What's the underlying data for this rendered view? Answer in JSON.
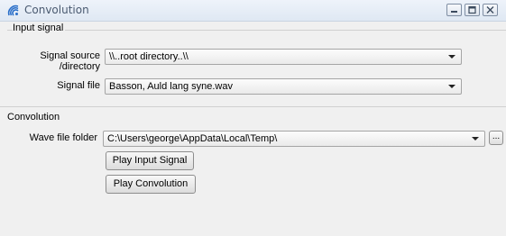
{
  "window": {
    "title": "Convolution",
    "icon": "convolution-wave-icon",
    "controls": [
      "minimize-icon",
      "maximize-icon",
      "close-icon"
    ]
  },
  "input_signal": {
    "group_label": "Input signal",
    "signal_source_label": "Signal source /directory",
    "signal_source_value": "\\\\..root directory..\\\\",
    "signal_file_label": "Signal file",
    "signal_file_value": "Basson, Auld lang syne.wav"
  },
  "convolution": {
    "group_label": "Convolution",
    "wave_folder_label": "Wave file folder",
    "wave_folder_value": "C:\\Users\\george\\AppData\\Local\\Temp\\",
    "browse_label": "...",
    "play_input_label": "Play Input Signal",
    "play_convolution_label": "Play Convolution"
  }
}
